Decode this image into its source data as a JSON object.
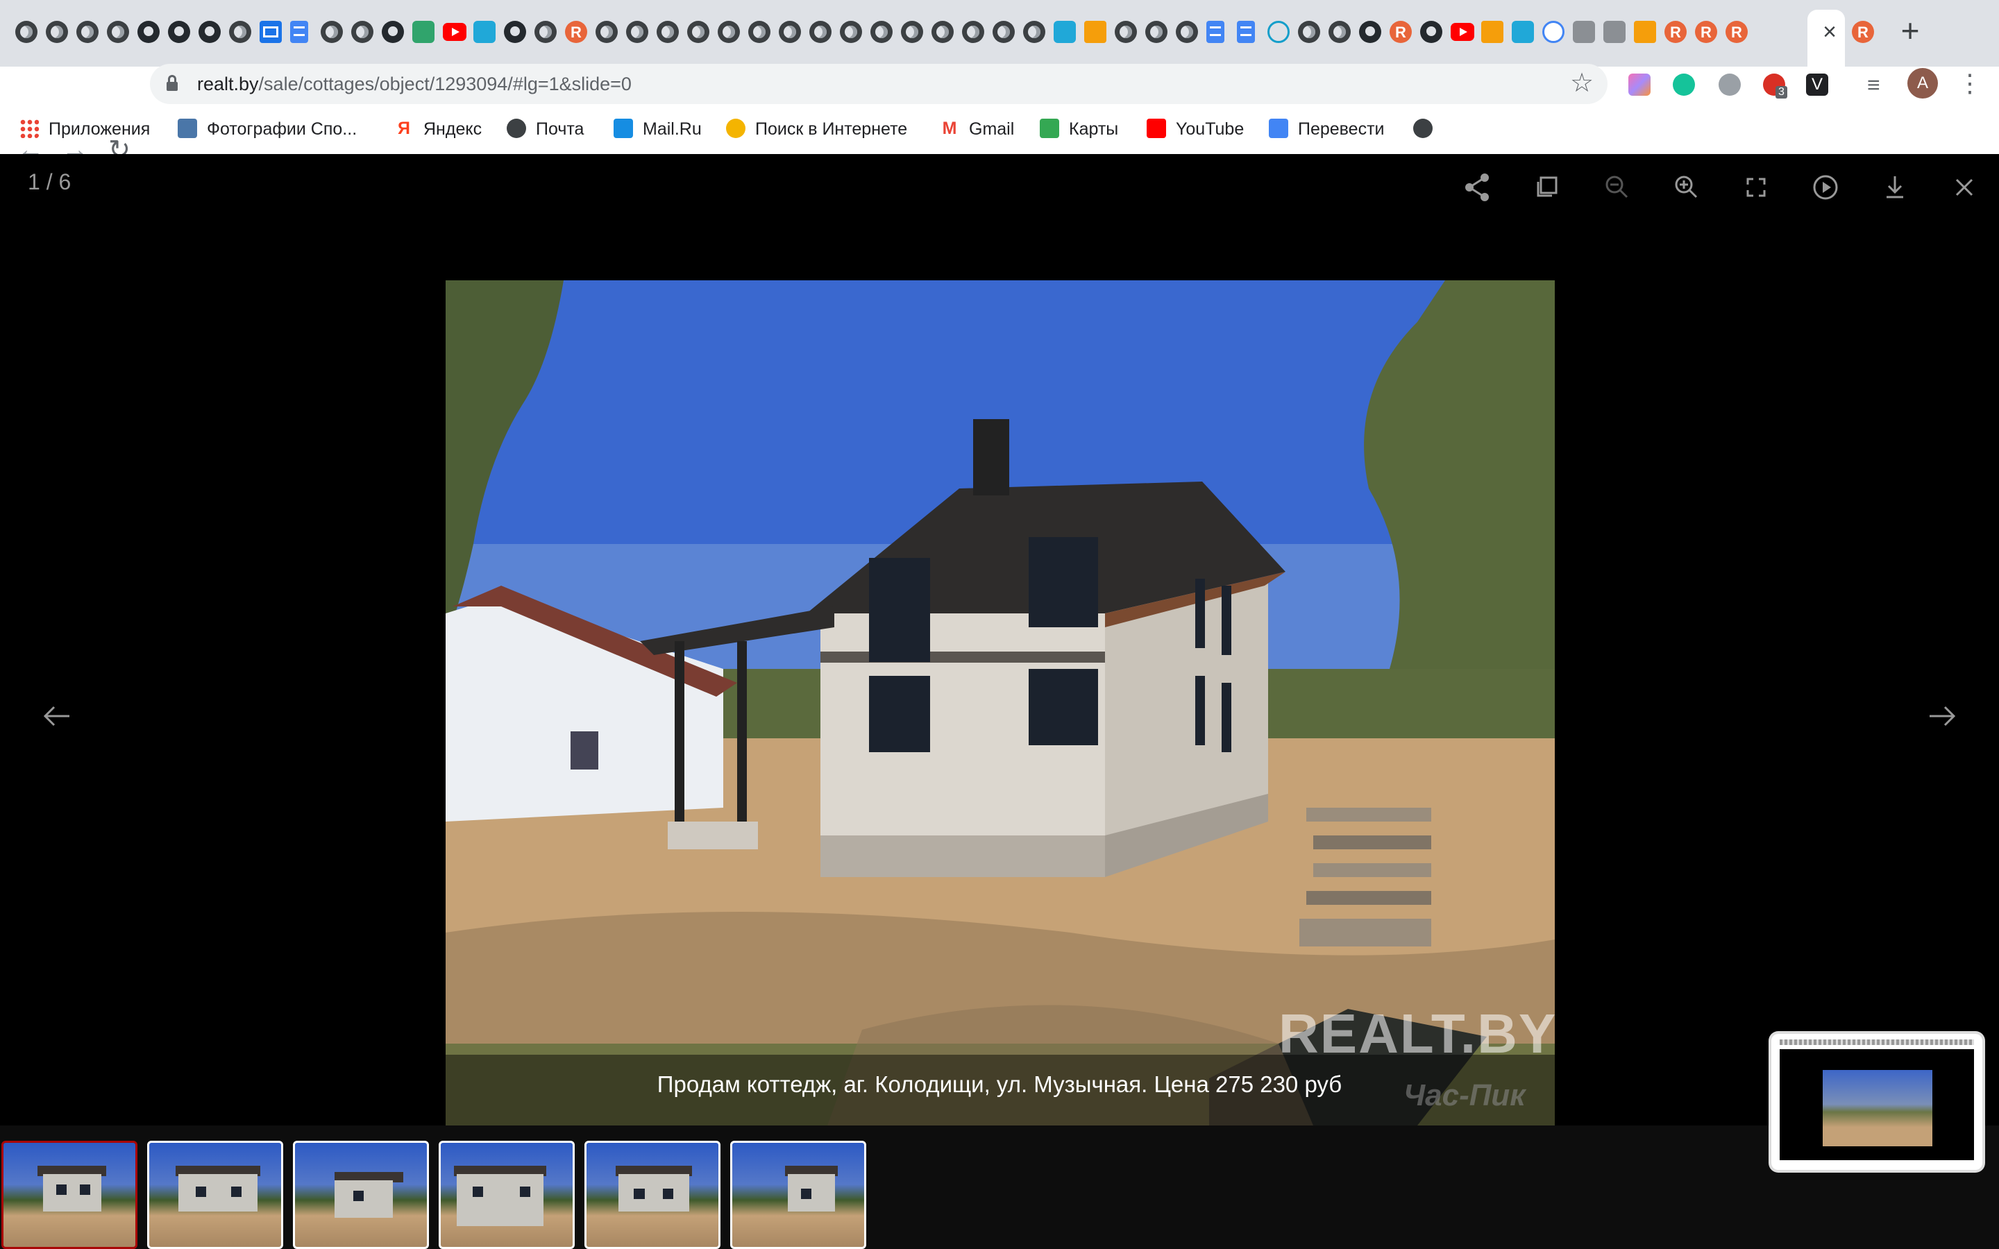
{
  "browser": {
    "url_host": "realt.by",
    "url_path": "/sale/cottages/object/1293094/#lg=1&slide=0",
    "profile_initial": "A",
    "extension_badge": "3"
  },
  "bookmarks": [
    {
      "label": "Приложения",
      "icon": "apps-grid-icon"
    },
    {
      "label": "Фотографии Спо...",
      "icon": "vk-icon"
    },
    {
      "label": "Яндекс",
      "icon": "yandex-icon"
    },
    {
      "label": "Почта",
      "icon": "globe-icon"
    },
    {
      "label": "Mail.Ru",
      "icon": "mailru-icon"
    },
    {
      "label": "Поиск в Интернете",
      "icon": "search-globe-icon"
    },
    {
      "label": "Gmail",
      "icon": "gmail-icon"
    },
    {
      "label": "Карты",
      "icon": "maps-icon"
    },
    {
      "label": "YouTube",
      "icon": "youtube-icon"
    },
    {
      "label": "Перевести",
      "icon": "translate-icon"
    },
    {
      "label": "",
      "icon": "globe-icon"
    }
  ],
  "gallery": {
    "counter": "1 / 6",
    "caption": "Продам коттедж, аг. Колодищи, ул. Музычная. Цена 275 230 руб",
    "watermark": "REALT.BY",
    "watermark_partner": "Час-Пик",
    "thumbnail_count": 6,
    "active_index": 0
  },
  "colors": {
    "viewer_bg": "#000000",
    "active_thumb_border": "#a90707",
    "tabstrip_bg": "#dee1e6"
  }
}
